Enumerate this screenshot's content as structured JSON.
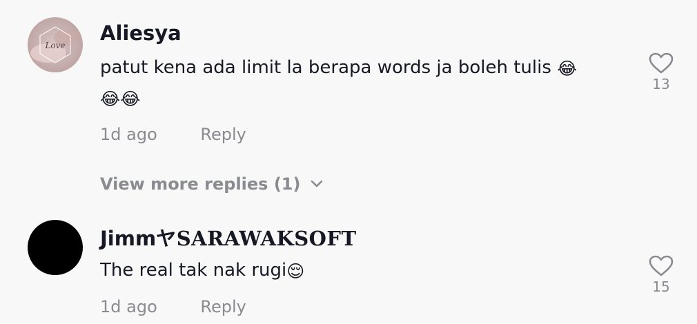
{
  "comments": [
    {
      "username": "Aliesya",
      "avatar_text": "Love",
      "text_line1": "patut kena ada limit la berapa words ja boleh tulis ",
      "text_line2": "",
      "emoji_laugh": "😂",
      "time": "1d ago",
      "reply_label": "Reply",
      "likes": "13",
      "view_more": "View more replies (1)"
    },
    {
      "username_prefix": "Jimm",
      "username_symbol": "ヤ",
      "username_styled": "SARAWAKSOFT",
      "text": "The real tak nak rugi",
      "emoji_relieved": "😌",
      "time": "1d ago",
      "reply_label": "Reply",
      "likes": "15"
    }
  ],
  "icons": {
    "heart": "heart-outline-icon",
    "chevron": "chevron-down-icon"
  },
  "colors": {
    "background": "#f8f8f8",
    "text_primary": "#161823",
    "text_secondary": "#8a8b91"
  }
}
